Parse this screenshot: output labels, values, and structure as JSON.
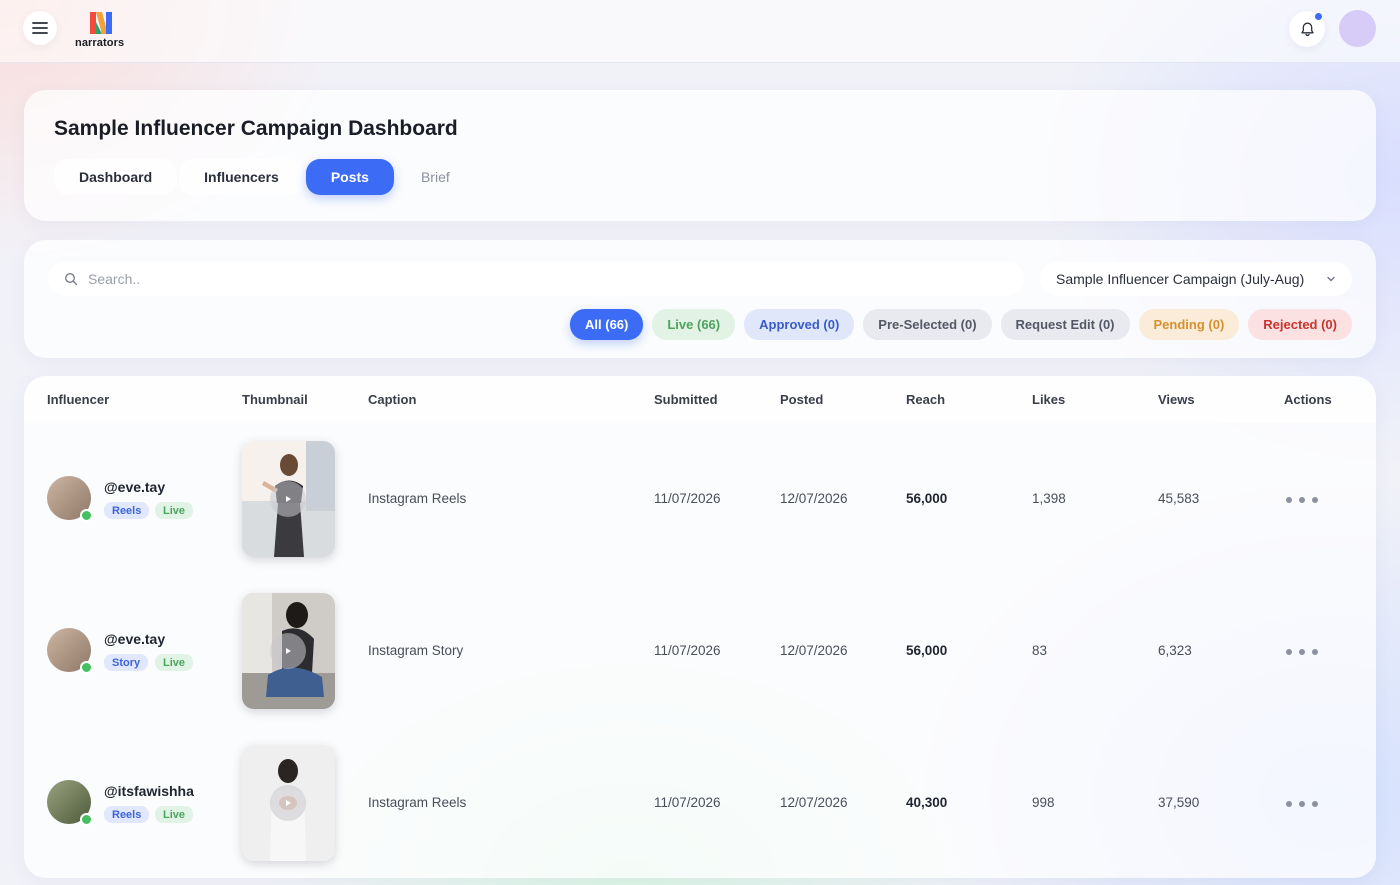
{
  "app": {
    "logo_text": "narrators"
  },
  "header": {
    "title": "Sample Influencer Campaign Dashboard",
    "tabs": [
      {
        "label": "Dashboard"
      },
      {
        "label": "Influencers"
      },
      {
        "label": "Posts"
      },
      {
        "label": "Brief"
      }
    ],
    "active_tab": "Posts"
  },
  "filter_bar": {
    "search_placeholder": "Search..",
    "campaign_selected": "Sample Influencer Campaign (July-Aug)",
    "chips": [
      {
        "label": "All (66)",
        "bg": "#3c6cf5",
        "fg": "#ffffff"
      },
      {
        "label": "Live (66)",
        "bg": "#e2f3e5",
        "fg": "#4ca35d"
      },
      {
        "label": "Approved (0)",
        "bg": "#e0e7fb",
        "fg": "#3a5cc9"
      },
      {
        "label": "Pre-Selected (0)",
        "bg": "#e9eaef",
        "fg": "#545866"
      },
      {
        "label": "Request Edit (0)",
        "bg": "#e9eaef",
        "fg": "#545866"
      },
      {
        "label": "Pending (0)",
        "bg": "#fbecd9",
        "fg": "#d7902f"
      },
      {
        "label": "Rejected (0)",
        "bg": "#fbe1e1",
        "fg": "#c8352f"
      }
    ]
  },
  "table": {
    "columns": [
      "Influencer",
      "Thumbnail",
      "Caption",
      "Submitted",
      "Posted",
      "Reach",
      "Likes",
      "Views",
      "Actions"
    ],
    "rows": [
      {
        "handle": "@eve.tay",
        "type": "Reels",
        "status": "Live",
        "caption": "Instagram Reels",
        "submitted": "11/07/2026",
        "posted": "12/07/2026",
        "reach": "56,000",
        "likes": "1,398",
        "views": "45,583"
      },
      {
        "handle": "@eve.tay",
        "type": "Story",
        "status": "Live",
        "caption": "Instagram Story",
        "submitted": "11/07/2026",
        "posted": "12/07/2026",
        "reach": "56,000",
        "likes": "83",
        "views": "6,323"
      },
      {
        "handle": "@itsfawishha",
        "type": "Reels",
        "status": "Live",
        "caption": "Instagram Reels",
        "submitted": "11/07/2026",
        "posted": "12/07/2026",
        "reach": "40,300",
        "likes": "998",
        "views": "37,590"
      }
    ]
  },
  "icons": {
    "menu": "menu-icon",
    "notification": "bell-icon",
    "search": "search-icon",
    "dropdown": "chevron-down-icon",
    "play": "play-icon",
    "actions": "more-horizontal-icon"
  },
  "colors": {
    "accent": "#3c6cf5",
    "online": "#44c15f",
    "notification_dot": "#3b6cf4",
    "user_avatar": "#d7ccf8"
  }
}
